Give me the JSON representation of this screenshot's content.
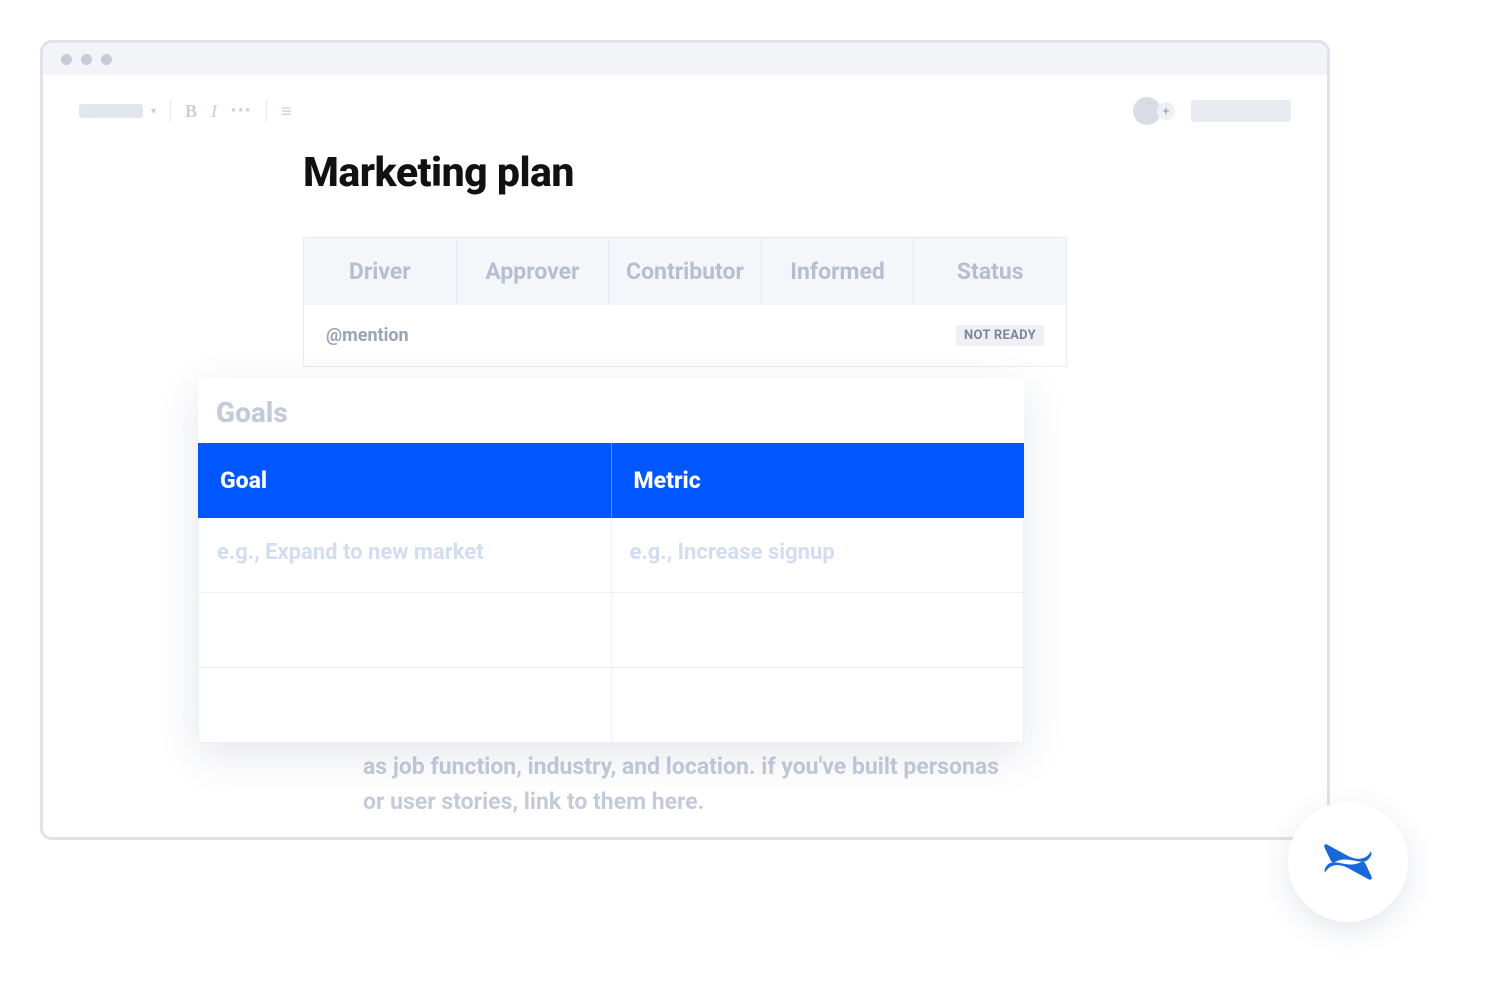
{
  "toolbar": {
    "bold": "B",
    "italic": "I",
    "more": "•••",
    "align": "≡",
    "avatar_plus": "+"
  },
  "page": {
    "title": "Marketing plan"
  },
  "roles": {
    "headers": [
      "Driver",
      "Approver",
      "Contributor",
      "Informed",
      "Status"
    ],
    "mention": "@mention",
    "status_badge": "NOT READY"
  },
  "goals": {
    "title": "Goals",
    "headers": [
      "Goal",
      "Metric"
    ],
    "rows": [
      {
        "goal": "e.g., Expand to new market",
        "metric": "e.g., Increase signup"
      },
      {
        "goal": "",
        "metric": ""
      },
      {
        "goal": "",
        "metric": ""
      }
    ]
  },
  "body_text": "as job function, industry, and location. if you've built personas or user stories, link to them here.",
  "colors": {
    "accent": "#0057ff"
  }
}
